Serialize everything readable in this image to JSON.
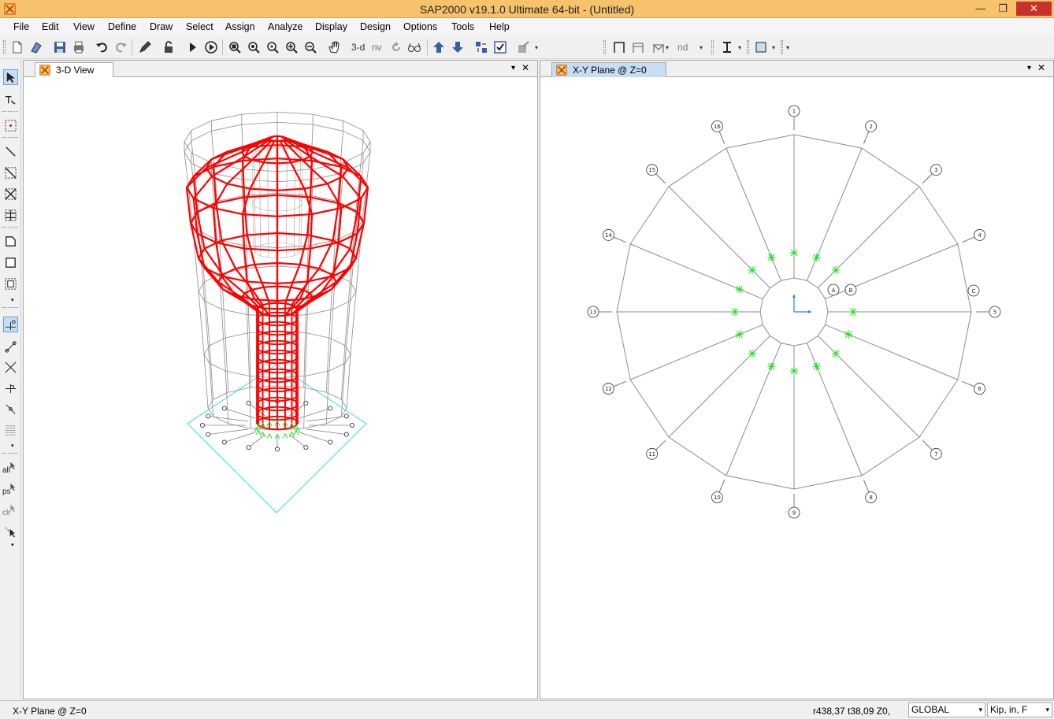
{
  "window": {
    "title": "SAP2000 v19.1.0 Ultimate 64-bit - (Untitled)",
    "min_glyph": "—",
    "max_glyph": "❐",
    "close_glyph": "✕"
  },
  "menu": [
    "File",
    "Edit",
    "View",
    "Define",
    "Draw",
    "Select",
    "Assign",
    "Analyze",
    "Display",
    "Design",
    "Options",
    "Tools",
    "Help"
  ],
  "toolbar": {
    "view_3d_label": "3-d",
    "view_nv_label": "nv",
    "nd_label": "nd",
    "icons": [
      "new-file-icon",
      "open-icon",
      "save-icon",
      "print-icon",
      "undo-icon",
      "redo-icon",
      "pencil-icon",
      "lock-icon",
      "run-icon",
      "run-step-icon",
      "zoom-window-icon",
      "zoom-restore-icon",
      "zoom-extents-icon",
      "zoom-in-icon",
      "zoom-out-icon",
      "pan-hand-icon",
      "rotate-icon",
      "perspective-icon",
      "move-up-icon",
      "move-down-icon",
      "display-options-icon",
      "check-icon",
      "assign-icon"
    ]
  },
  "left_tools": {
    "all_label": "all",
    "ps_label": "ps",
    "clr_label": "clr"
  },
  "panels": {
    "left": {
      "tab": "3-D View"
    },
    "right": {
      "tab": "X-Y Plane @ Z=0"
    },
    "close_glyph": "✕",
    "dropdown_glyph": "▾"
  },
  "plan_labels": {
    "outer": [
      "1",
      "2",
      "3",
      "4",
      "5",
      "6",
      "7",
      "8",
      "9",
      "10",
      "11",
      "12",
      "13",
      "14",
      "15",
      "16"
    ],
    "inner_letters": [
      "A",
      "B",
      "C"
    ]
  },
  "colors": {
    "titlebar": "#f6c26b",
    "frame_red": "#ff0000",
    "frame_gray": "#8c8c8c",
    "restraint_green": "#22dd22",
    "base_cyan": "#3fd8e6",
    "axis_blue": "#2080ff"
  },
  "status": {
    "left_text": "X-Y Plane @ Z=0",
    "coords": "r438,37  t38,09  Z0,",
    "coord_system": "GLOBAL",
    "units": "Kip, in, F"
  }
}
